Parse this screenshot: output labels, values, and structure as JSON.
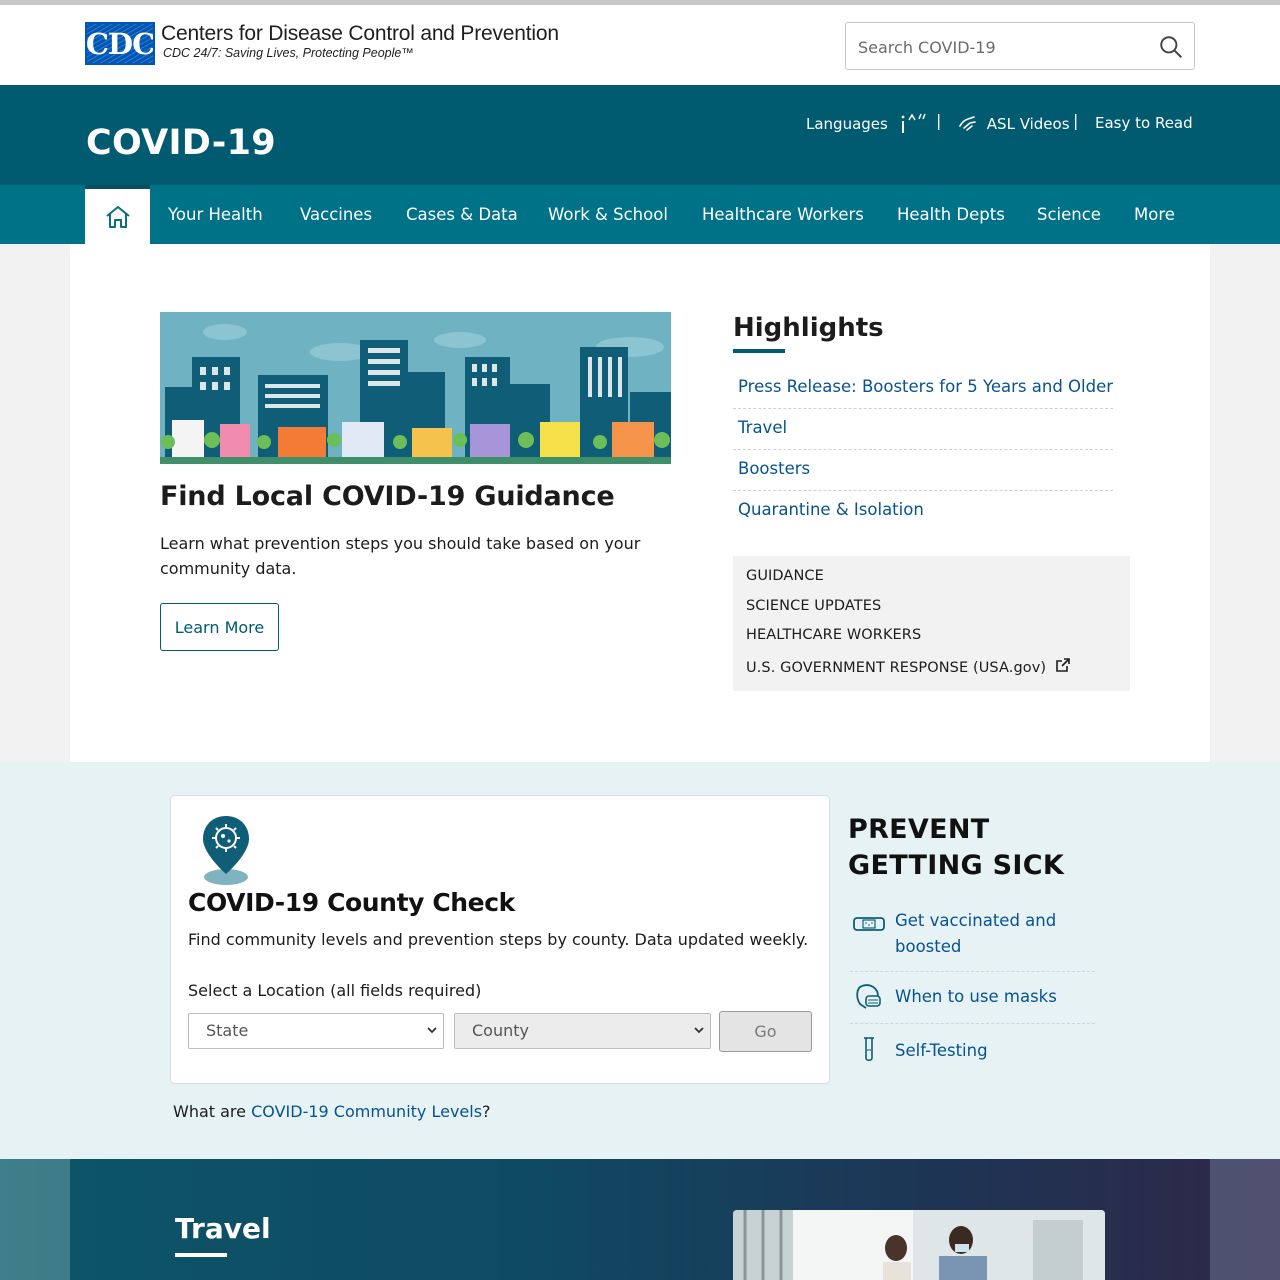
{
  "header": {
    "logo_letters": "CDC",
    "org_name": "Centers for Disease Control and Prevention",
    "tagline": "CDC 24/7: Saving Lives, Protecting People™",
    "search_placeholder": "Search COVID-19"
  },
  "title_band": {
    "title": "COVID-19",
    "languages": "Languages",
    "asl": "ASL Videos",
    "easy_read": "Easy to Read",
    "separator": "|"
  },
  "nav": {
    "items": [
      "Your Health",
      "Vaccines",
      "Cases & Data",
      "Work & School",
      "Healthcare Workers",
      "Health Depts",
      "Science",
      "More"
    ]
  },
  "feature": {
    "title": "Find Local COVID-19 Guidance",
    "description": "Learn what prevention steps you should take based on your community data.",
    "button": "Learn More"
  },
  "highlights": {
    "title": "Highlights",
    "links": [
      "Press Release: Boosters for 5 Years and Older",
      "Travel",
      "Boosters",
      "Quarantine & Isolation"
    ],
    "box_links": [
      "GUIDANCE",
      "SCIENCE UPDATES",
      "HEALTHCARE WORKERS",
      "U.S. GOVERNMENT RESPONSE (USA.gov)"
    ]
  },
  "county_check": {
    "title": "COVID-19 County Check",
    "description": "Find community levels and prevention steps by county. Data updated weekly.",
    "select_label": "Select a Location (all fields required)",
    "state_value": "State",
    "county_value": "County",
    "go": "Go",
    "note_prefix": "What are ",
    "note_link": "COVID-19 Community Levels",
    "note_suffix": "?"
  },
  "prevent": {
    "title": "PREVENT GETTING SICK",
    "items": [
      {
        "label": "Get vaccinated and boosted",
        "icon": "bandage-icon"
      },
      {
        "label": "When to use masks",
        "icon": "mask-face-icon"
      },
      {
        "label": "Self-Testing",
        "icon": "test-tube-icon"
      }
    ]
  },
  "travel": {
    "title": "Travel"
  },
  "colors": {
    "title_band": "#005a70",
    "nav": "#007287",
    "link": "#075290"
  }
}
